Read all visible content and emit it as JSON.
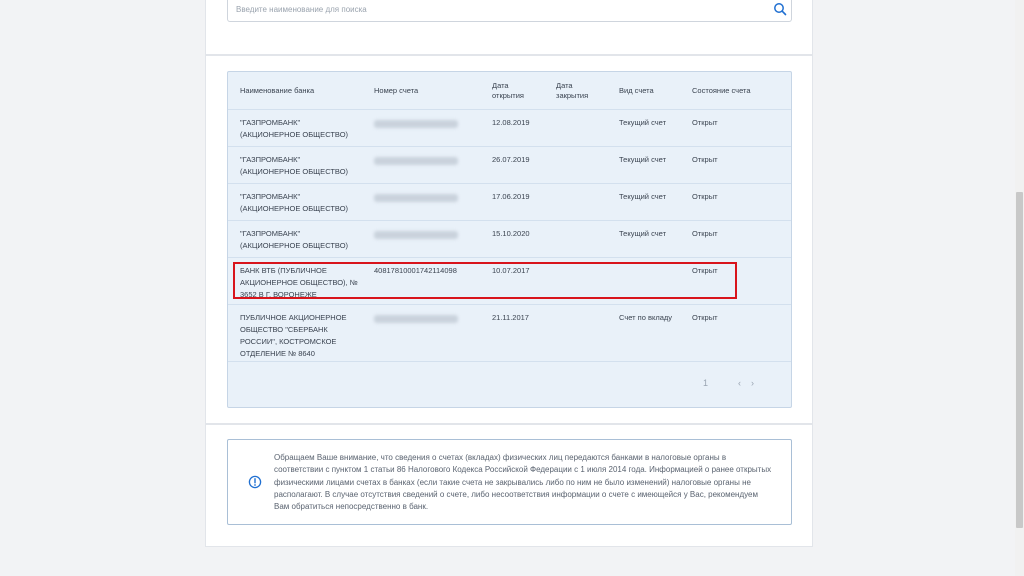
{
  "search": {
    "placeholder": "Введите наименование для поиска",
    "icon": "search-icon"
  },
  "table": {
    "headers": {
      "bank": "Наименование банка",
      "account": "Номер счета",
      "open_date_1": "Дата",
      "open_date_2": "открытия",
      "close_date_1": "Дата",
      "close_date_2": "закрытия",
      "type": "Вид счета",
      "status": "Состояние счета"
    },
    "rows": [
      {
        "bank": "\"ГАЗПРОМБАНК\"\n(АКЦИОНЕРНОЕ ОБЩЕСТВО)",
        "account": "",
        "opened": "12.08.2019",
        "closed": "",
        "type": "Текущий счет",
        "status": "Открыт"
      },
      {
        "bank": "\"ГАЗПРОМБАНК\"\n(АКЦИОНЕРНОЕ ОБЩЕСТВО)",
        "account": "",
        "opened": "26.07.2019",
        "closed": "",
        "type": "Текущий счет",
        "status": "Открыт"
      },
      {
        "bank": "\"ГАЗПРОМБАНК\"\n(АКЦИОНЕРНОЕ ОБЩЕСТВО)",
        "account": "",
        "opened": "17.06.2019",
        "closed": "",
        "type": "Текущий счет",
        "status": "Открыт"
      },
      {
        "bank": "\"ГАЗПРОМБАНК\"\n(АКЦИОНЕРНОЕ ОБЩЕСТВО)",
        "account": "",
        "opened": "15.10.2020",
        "closed": "",
        "type": "Текущий счет",
        "status": "Открыт"
      },
      {
        "bank": "БАНК ВТБ (ПУБЛИЧНОЕ\nАКЦИОНЕРНОЕ ОБЩЕСТВО), №\n3652 В Г. ВОРОНЕЖЕ",
        "account": "40817810001742114098",
        "opened": "10.07.2017",
        "closed": "",
        "type": "",
        "status": "Открыт"
      },
      {
        "bank": "ПУБЛИЧНОЕ АКЦИОНЕРНОЕ\nОБЩЕСТВО \"СБЕРБАНК\nРОССИИ\", КОСТРОМСКОЕ\nОТДЕЛЕНИЕ № 8640",
        "account": "",
        "opened": "21.11.2017",
        "closed": "",
        "type": "Счет по вкладу",
        "status": "Открыт"
      }
    ]
  },
  "pagination": {
    "current": "1",
    "prev": "‹",
    "next": "›"
  },
  "notice": {
    "icon": "info-icon",
    "text": "Обращаем Ваше внимание, что сведения о счетах (вкладах) физических лиц передаются банками в налоговые органы в соответствии с пунктом 1 статьи 86 Налогового Кодекса Российской Федерации с 1 июля 2014 года. Информацией о ранее открытых физическими лицами счетах в банках (если такие счета не закрывались либо по ним не было изменений) налоговые органы не располагают. В случае отсутствия сведений о счете, либо несоответствия информации о счете с имеющейся у Вас, рекомендуем Вам обратиться непосредственно в банк."
  },
  "colors": {
    "accent": "#1f6fd1",
    "highlight": "#d8141c",
    "table_bg": "#e9f1f9"
  }
}
